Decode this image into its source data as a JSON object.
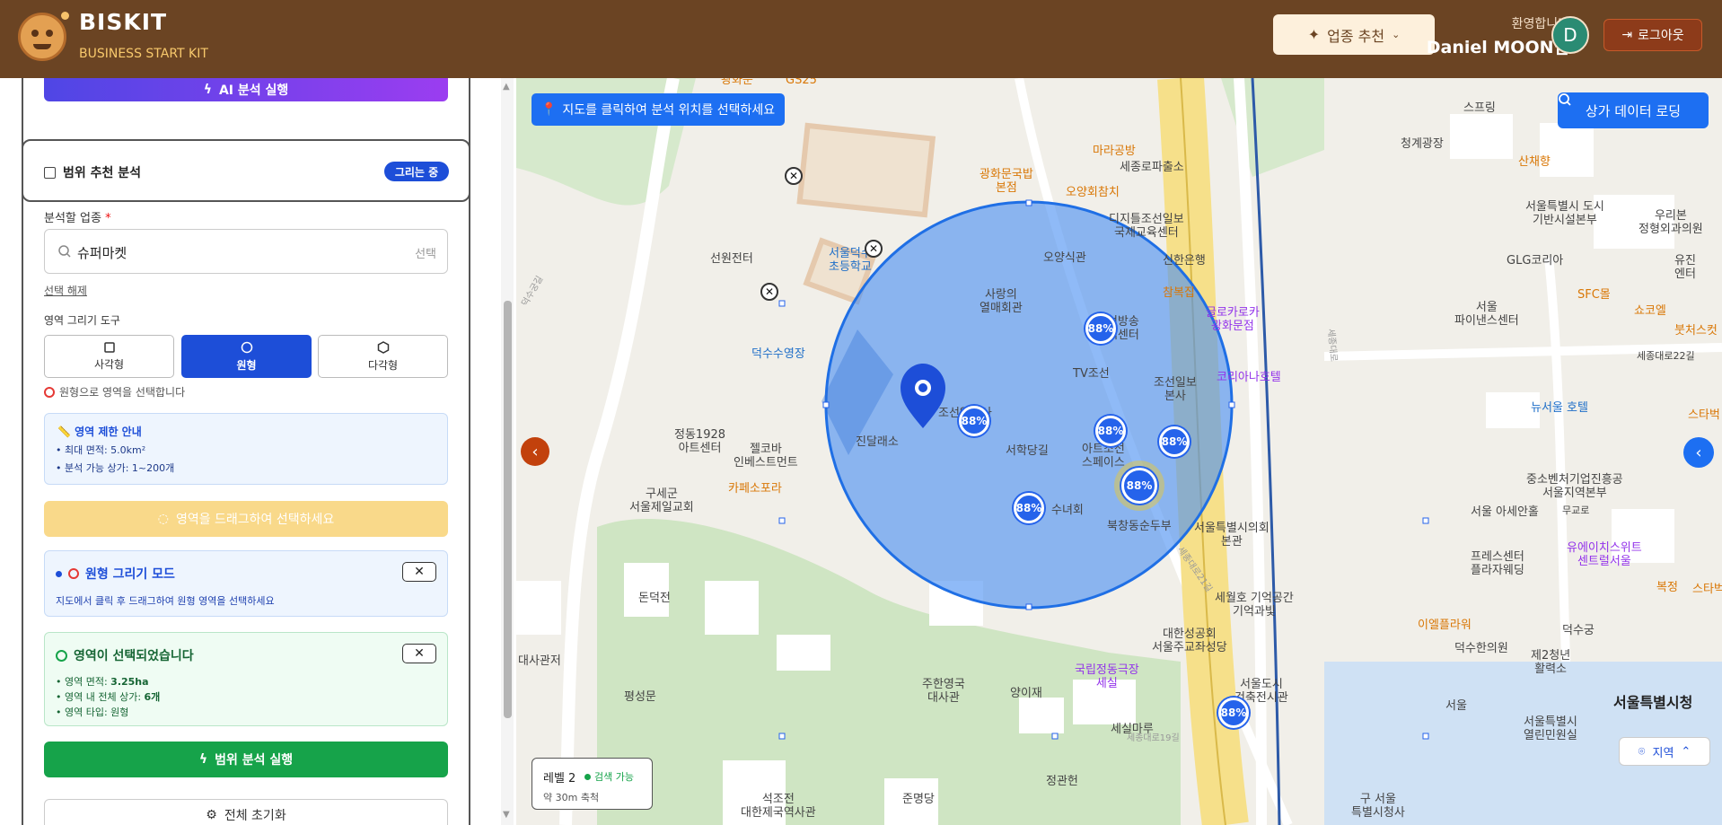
{
  "header": {
    "brand": "BISKIT",
    "brand_sub": "BUSINESS START KIT",
    "recommend_label": "업종 추천",
    "welcome": "환영합니다",
    "username": "Daniel MOON님",
    "avatar_initial": "D",
    "logout_label": "로그아웃"
  },
  "sidebar": {
    "ai_button": "AI 분석 실행",
    "range_title": "범위 추천 분석",
    "drawing_badge": "그리는 중",
    "business_label": "분석할 업종",
    "required_mark": "*",
    "business_value": "슈퍼마켓",
    "business_select": "선택",
    "clear_selection": "선택 해제",
    "draw_tool_label": "영역 그리기 도구",
    "tools": [
      "사각형",
      "원형",
      "다각형"
    ],
    "active_tool_index": 1,
    "mode_hint": "원형으로 영역을 선택합니다",
    "limit": {
      "title": "영역 제한 안내",
      "line1": "• 최대 면적: 5.0km²",
      "line2": "• 분석 가능 상가: 1~200개"
    },
    "drag_button": "영역을 드래그하여 선택하세요",
    "mode_box": {
      "title": "원형 그리기 모드",
      "desc": "지도에서 클릭 후 드래그하여 원형 영역을 선택하세요"
    },
    "selected_box": {
      "title": "영역이 선택되었습니다",
      "area_label": "• 영역 면적: ",
      "area_value": "3.25ha",
      "stores_label": "• 영역 내 전체 상가: ",
      "stores_value": "6개",
      "type_label": "• 영역 타입: 원형"
    },
    "run_button": "범위 분석 실행",
    "reset_button": "전체 초기화"
  },
  "map": {
    "hint": "지도를 클릭하여 분석 위치를 선택하세요",
    "load_button": "상가 데이터 로딩",
    "level_label": "레벨 2",
    "level_status": "검색 가능",
    "level_scale": "약 30m 축척",
    "region_button": "지역",
    "markers": [
      "88%",
      "88%",
      "88%",
      "88%",
      "88%",
      "88%",
      "88%"
    ],
    "places": [
      {
        "t": "광화문",
        "c": "o"
      },
      {
        "t": "GS25",
        "c": "o"
      },
      {
        "t": "스프링",
        "c": ""
      },
      {
        "t": "청계광장",
        "c": ""
      },
      {
        "t": "마라공방",
        "c": "o"
      },
      {
        "t": "세종로파출소",
        "c": ""
      },
      {
        "t": "광화문국밥\n본점",
        "c": "o"
      },
      {
        "t": "오양회참치",
        "c": "o"
      },
      {
        "t": "산채향",
        "c": "o"
      },
      {
        "t": "서울특별시 도시\n기반시설본부",
        "c": ""
      },
      {
        "t": "우리본\n정형외과의원",
        "c": ""
      },
      {
        "t": "디지틀조선일보\n국제교육센터",
        "c": ""
      },
      {
        "t": "선원전터",
        "c": ""
      },
      {
        "t": "서울덕수\n초등학교",
        "c": "b"
      },
      {
        "t": "오양식관",
        "c": ""
      },
      {
        "t": "신한은행",
        "c": ""
      },
      {
        "t": "GLG코리아",
        "c": ""
      },
      {
        "t": "유진\n엔터",
        "c": ""
      },
      {
        "t": "사랑의\n열매회관",
        "c": ""
      },
      {
        "t": "참복집",
        "c": "o"
      },
      {
        "t": "SFC몰",
        "c": "o"
      },
      {
        "t": "쇼코엘",
        "c": "o"
      },
      {
        "t": "글로카로카\n광화문점",
        "c": "p"
      },
      {
        "t": "서울\n파이낸스센터",
        "c": ""
      },
      {
        "t": "붓처스컷",
        "c": "o"
      },
      {
        "t": "조선방송\n고객센터",
        "c": ""
      },
      {
        "t": "덕수수영장",
        "c": "b"
      },
      {
        "t": "세종대로22길",
        "c": ""
      },
      {
        "t": "TV조선",
        "c": ""
      },
      {
        "t": "조선일보\n본사",
        "c": ""
      },
      {
        "t": "코리아나호텔",
        "c": "p"
      },
      {
        "t": "스타벅",
        "c": "o"
      },
      {
        "t": "뉴서울 호텔",
        "c": "b"
      },
      {
        "t": "정동1928\n아트센터",
        "c": ""
      },
      {
        "t": "조선일보사",
        "c": ""
      },
      {
        "t": "진달래소",
        "c": ""
      },
      {
        "t": "젤코바\n인베스트먼트",
        "c": ""
      },
      {
        "t": "서학당길",
        "c": ""
      },
      {
        "t": "아트조선\n스페이스",
        "c": ""
      },
      {
        "t": "중소벤처기업진흥공\n서울지역본부",
        "c": ""
      },
      {
        "t": "구세군\n서울제일교회",
        "c": ""
      },
      {
        "t": "카페소포라",
        "c": "o"
      },
      {
        "t": "수녀회",
        "c": ""
      },
      {
        "t": "북창동순두부",
        "c": ""
      },
      {
        "t": "서울특별시의회\n본관",
        "c": ""
      },
      {
        "t": "서울 아세안홀",
        "c": ""
      },
      {
        "t": "무교로",
        "c": ""
      },
      {
        "t": "프레스센터\n플라자웨딩",
        "c": ""
      },
      {
        "t": "유에이치스위트\n센트럴서울",
        "c": "p"
      },
      {
        "t": "복정",
        "c": "o"
      },
      {
        "t": "스타벅",
        "c": "o"
      },
      {
        "t": "덕수궁",
        "c": ""
      },
      {
        "t": "돈덕전",
        "c": ""
      },
      {
        "t": "세월호 기억공간\n기억과빛",
        "c": ""
      },
      {
        "t": "이엘플라워",
        "c": "o"
      },
      {
        "t": "덕수한의원",
        "c": ""
      },
      {
        "t": "대한성공회\n서울주교좌성당",
        "c": ""
      },
      {
        "t": "양이재",
        "c": ""
      },
      {
        "t": "제2청년\n활력소",
        "c": ""
      },
      {
        "t": "대사관저",
        "c": ""
      },
      {
        "t": "국립정동극장\n세실",
        "c": "p"
      },
      {
        "t": "서울도시\n건축전시관",
        "c": ""
      },
      {
        "t": "서울",
        "c": ""
      },
      {
        "t": "서울특별시청",
        "c": "big"
      },
      {
        "t": "평성문",
        "c": ""
      },
      {
        "t": "주한영국\n대사관",
        "c": ""
      },
      {
        "t": "세실마루",
        "c": ""
      },
      {
        "t": "서울특별시\n열린민원실",
        "c": ""
      },
      {
        "t": "정관헌",
        "c": ""
      },
      {
        "t": "석조전\n대한제국역사관",
        "c": ""
      },
      {
        "t": "준명당",
        "c": ""
      },
      {
        "t": "구 서울\n특별시청사",
        "c": ""
      },
      {
        "t": "세종대로19길",
        "c": ""
      },
      {
        "t": "세종대로21길",
        "c": ""
      },
      {
        "t": "덕수궁길",
        "c": ""
      },
      {
        "t": "세종대로",
        "c": ""
      }
    ]
  }
}
